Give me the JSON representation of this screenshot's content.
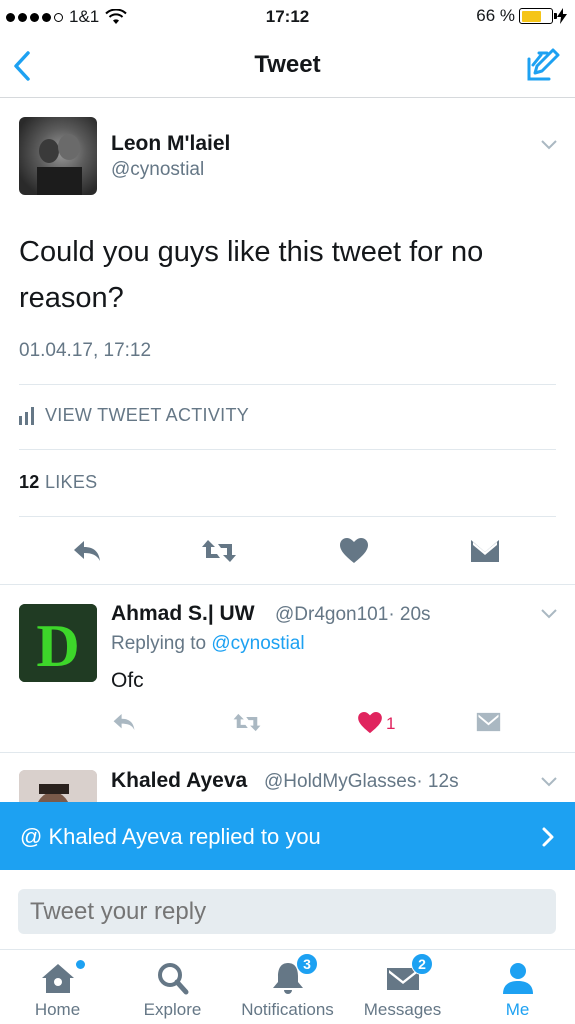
{
  "status_bar": {
    "carrier": "1&1",
    "time": "17:12",
    "battery": "66 %",
    "battery_level": 0.66
  },
  "nav": {
    "title": "Tweet"
  },
  "main_tweet": {
    "author_name": "Leon M'laiel",
    "author_handle": "@cynostial",
    "text": "Could you guys like this tweet for no reason?",
    "timestamp": "01.04.17, 17:12",
    "activity_label": "VIEW TWEET ACTIVITY",
    "likes_count": "12",
    "likes_label": "LIKES"
  },
  "replies": [
    {
      "author_name": "Ahmad S.| UW",
      "author_handle": "@Dr4gon101",
      "time": "· 20s",
      "replying_prefix": "Replying to",
      "replying_to": "@cynostial",
      "text": "Ofc",
      "like_count": "1",
      "avatar_letter": "D"
    },
    {
      "author_name": "Khaled Ayeva",
      "author_handle": "@HoldMyGlasses",
      "time": "· 12s"
    }
  ],
  "banner": {
    "text": "@  Khaled Ayeva replied to you"
  },
  "composer": {
    "placeholder": "Tweet your reply"
  },
  "tabs": [
    {
      "label": "Home",
      "icon": "home-icon"
    },
    {
      "label": "Explore",
      "icon": "search-icon"
    },
    {
      "label": "Notifications",
      "icon": "bell-icon",
      "badge": "3"
    },
    {
      "label": "Messages",
      "icon": "envelope-icon",
      "badge": "2"
    },
    {
      "label": "Me",
      "icon": "person-icon"
    }
  ],
  "colors": {
    "accent": "#1da1f2",
    "like": "#e0245e",
    "secondary_text": "#657786"
  }
}
